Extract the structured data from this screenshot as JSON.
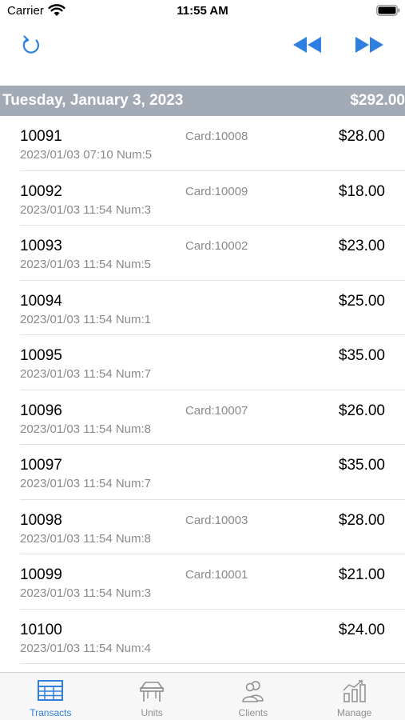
{
  "status_bar": {
    "carrier": "Carrier",
    "time": "11:55 AM"
  },
  "toolbar": {
    "refresh_icon": "refresh-icon",
    "rewind_icon": "rewind-icon",
    "forward_icon": "fast-forward-icon"
  },
  "accent_color": "#2f7fe0",
  "section": {
    "date": "Tuesday, January 3, 2023",
    "total": "$292.00"
  },
  "transactions": [
    {
      "id": "10091",
      "meta": "2023/01/03 07:10 Num:5",
      "card": "Card:10008",
      "amount": "$28.00"
    },
    {
      "id": "10092",
      "meta": "2023/01/03 11:54 Num:3",
      "card": "Card:10009",
      "amount": "$18.00"
    },
    {
      "id": "10093",
      "meta": "2023/01/03 11:54 Num:5",
      "card": "Card:10002",
      "amount": "$23.00"
    },
    {
      "id": "10094",
      "meta": "2023/01/03 11:54 Num:1",
      "card": "",
      "amount": "$25.00"
    },
    {
      "id": "10095",
      "meta": "2023/01/03 11:54 Num:7",
      "card": "",
      "amount": "$35.00"
    },
    {
      "id": "10096",
      "meta": "2023/01/03 11:54 Num:8",
      "card": "Card:10007",
      "amount": "$26.00"
    },
    {
      "id": "10097",
      "meta": "2023/01/03 11:54 Num:7",
      "card": "",
      "amount": "$35.00"
    },
    {
      "id": "10098",
      "meta": "2023/01/03 11:54 Num:8",
      "card": "Card:10003",
      "amount": "$28.00"
    },
    {
      "id": "10099",
      "meta": "2023/01/03 11:54 Num:3",
      "card": "Card:10001",
      "amount": "$21.00"
    },
    {
      "id": "10100",
      "meta": "2023/01/03 11:54 Num:4",
      "card": "",
      "amount": "$24.00"
    }
  ],
  "tabs": [
    {
      "label": "Transacts",
      "icon": "table-icon",
      "active": true
    },
    {
      "label": "Units",
      "icon": "table-furniture-icon",
      "active": false
    },
    {
      "label": "Clients",
      "icon": "people-icon",
      "active": false
    },
    {
      "label": "Manage",
      "icon": "bar-chart-icon",
      "active": false
    }
  ]
}
